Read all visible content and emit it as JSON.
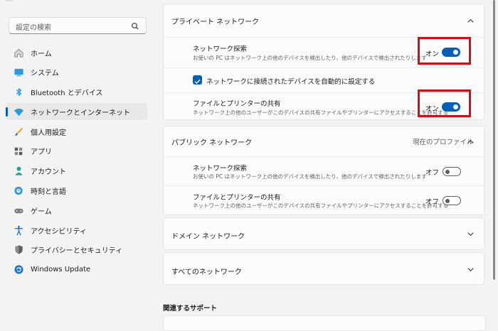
{
  "search": {
    "placeholder": "設定の検索"
  },
  "sidebar": {
    "items": [
      {
        "label": "ホーム",
        "icon": "home-icon"
      },
      {
        "label": "システム",
        "icon": "system-icon"
      },
      {
        "label": "Bluetooth とデバイス",
        "icon": "bluetooth-icon"
      },
      {
        "label": "ネットワークとインターネット",
        "icon": "wifi-icon",
        "active": true
      },
      {
        "label": "個人用設定",
        "icon": "brush-icon"
      },
      {
        "label": "アプリ",
        "icon": "apps-icon"
      },
      {
        "label": "アカウント",
        "icon": "account-icon"
      },
      {
        "label": "時刻と言語",
        "icon": "globe-clock-icon"
      },
      {
        "label": "ゲーム",
        "icon": "gamepad-icon"
      },
      {
        "label": "アクセシビリティ",
        "icon": "accessibility-icon"
      },
      {
        "label": "プライバシーとセキュリティ",
        "icon": "shield-icon"
      },
      {
        "label": "Windows Update",
        "icon": "update-icon"
      }
    ]
  },
  "private_network": {
    "title": "プライベート ネットワーク",
    "discovery": {
      "title": "ネットワーク探索",
      "desc": "お使いの PC はネットワーク上の他のデバイスを検出したり、他のデバイスで検出されたりします",
      "state_label": "オン",
      "on": true
    },
    "auto_setup": {
      "label": "ネットワークに接続されたデバイスを自動的に設定する",
      "checked": true
    },
    "sharing": {
      "title": "ファイルとプリンターの共有",
      "desc": "ネットワーク上の他のユーザーがこのデバイスの共有ファイルやプリンターにアクセスすることを許可する",
      "state_label": "オン",
      "on": true
    }
  },
  "public_network": {
    "title": "パブリック ネットワーク",
    "current_profile": "現在のプロファイル",
    "discovery": {
      "title": "ネットワーク探索",
      "desc": "お使いの PC はネットワーク上の他のデバイスを検出したり、他のデバイスで検出されたりします",
      "state_label": "オフ",
      "on": false
    },
    "sharing": {
      "title": "ファイルとプリンターの共有",
      "desc": "ネットワーク上の他のユーザーがこのデバイスの共有ファイルやプリンターにアクセスすることを許可する",
      "state_label": "オフ",
      "on": false
    }
  },
  "domain_network": {
    "title": "ドメイン ネットワーク"
  },
  "all_networks": {
    "title": "すべてのネットワーク"
  },
  "related_support": {
    "title": "関連するサポート"
  },
  "colors": {
    "accent": "#005fb8",
    "highlight": "#d10f19"
  }
}
